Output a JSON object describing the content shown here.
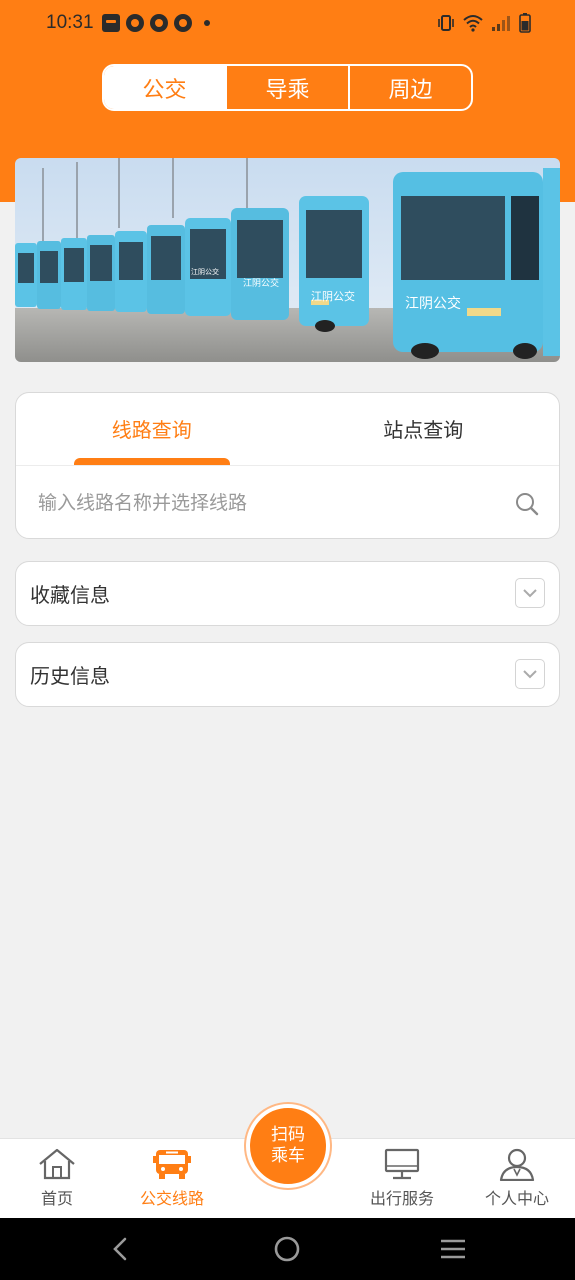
{
  "status_bar": {
    "time": "10:31",
    "notification_icons": [
      "bag-icon",
      "app-icon",
      "app-icon",
      "app-icon"
    ],
    "system_icons": [
      "vibrate-icon",
      "wifi-icon",
      "signal-icon",
      "battery-icon"
    ]
  },
  "top_tabs": {
    "items": [
      {
        "label": "公交",
        "active": true
      },
      {
        "label": "导乘",
        "active": false
      },
      {
        "label": "周边",
        "active": false
      }
    ]
  },
  "banner": {
    "bus_side_text": "江阴公交"
  },
  "query": {
    "tabs": [
      {
        "label": "线路查询",
        "active": true
      },
      {
        "label": "站点查询",
        "active": false
      }
    ],
    "search_placeholder": "输入线路名称并选择线路"
  },
  "sections": {
    "favorites": {
      "label": "收藏信息"
    },
    "history": {
      "label": "历史信息"
    }
  },
  "bottom_nav": {
    "items": [
      {
        "label": "首页",
        "icon": "home-icon",
        "active": false
      },
      {
        "label": "公交线路",
        "icon": "bus-icon",
        "active": true
      },
      {
        "label": "出行服务",
        "icon": "monitor-icon",
        "active": false
      },
      {
        "label": "个人中心",
        "icon": "user-icon",
        "active": false
      }
    ],
    "scan_button": {
      "line1": "扫码",
      "line2": "乘车"
    }
  },
  "colors": {
    "brand": "#ff7e14",
    "bus_body": "#5bc3e6",
    "background": "#f1f1f1"
  }
}
